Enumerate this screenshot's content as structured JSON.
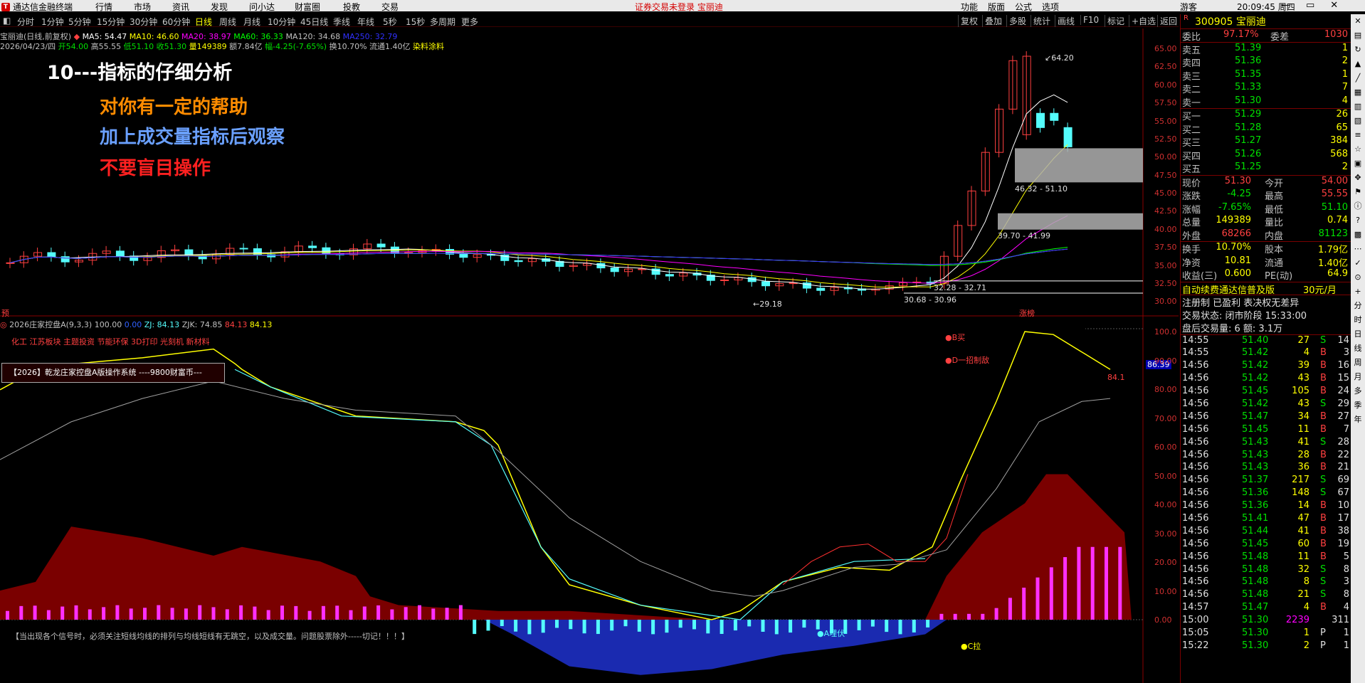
{
  "window": {
    "app_title": "通达信金融终端",
    "menus": [
      "行情",
      "市场",
      "资讯",
      "发现",
      "问小达",
      "财富圈",
      "投教",
      "交易"
    ],
    "login_warning": "证券交易未登录  宝丽迪",
    "right_menus": [
      "功能",
      "版面",
      "公式",
      "选项"
    ],
    "user": "游客",
    "clock": "20:09:45 周四",
    "controls": [
      "—",
      "▭",
      "✕"
    ]
  },
  "periods": [
    "分时",
    "1分钟",
    "5分钟",
    "15分钟",
    "30分钟",
    "60分钟",
    "日线",
    "周线",
    "月线",
    "10分钟",
    "45日线",
    "季线",
    "年线",
    "5秒",
    "15秒",
    "多周期",
    "更多"
  ],
  "active_period": "日线",
  "tools": [
    "复权",
    "叠加",
    "多股",
    "统计",
    "画线",
    "F10",
    "标记",
    "+自选",
    "返回"
  ],
  "stock": {
    "line1_name": "宝丽迪(日线,前复权)",
    "ma5": "MA5: 54.47",
    "ma10": "MA10: 46.60",
    "ma20": "MA20: 38.97",
    "ma60": "MA60: 36.33",
    "ma120": "MA120: 34.68",
    "ma250": "MA250: 32.79",
    "line2_date": "2026/04/23/四",
    "line2_open": "开54.00",
    "line2_high": "高55.55",
    "line2_low": "低51.10",
    "line2_close": "收51.30",
    "line2_vol": "量149389",
    "line2_amount": "额7.84亿",
    "line2_change": "幅-4.25(-7.65%)",
    "line2_turnover": "换10.70%",
    "line2_float": "流通1.40亿",
    "line2_industry": "染料涂料"
  },
  "overlay": {
    "title": "10---指标的仔细分析",
    "line1": "对你有一定的帮助",
    "line2": "加上成交量指标后观察",
    "line3": "不要盲目操作",
    "color_title": "#ffffff",
    "color_line1": "#ff8c00",
    "color_line2": "#6aa0ff",
    "color_line3": "#ff2020"
  },
  "price_annotations": {
    "high": "64.20",
    "low": "29.18",
    "zone1": "46.32 - 51.10",
    "zone2": "39.70 - 41.99",
    "zone3": "32.28 - 32.71",
    "zone4": "30.68 - 30.96",
    "pre_label": "预",
    "limit_up": "涨榜"
  },
  "price_scale": [
    "65.00",
    "62.50",
    "60.00",
    "57.50",
    "55.00",
    "52.50",
    "50.00",
    "47.50",
    "45.00",
    "42.50",
    "40.00",
    "37.50",
    "35.00",
    "32.50",
    "30.00"
  ],
  "indicator": {
    "name": "2026庄家控盘A(9,3,3)",
    "v1": "100.00",
    "v2": "0.00",
    "zj": "ZJ: 84.13",
    "zjk": "ZJK: 74.85",
    "v3": "84.13",
    "v4": "84.13",
    "tags": "化工 江苏板块 主题投资 节能环保 3D打印 光刻机 新材料",
    "banner": "【2026】乾龙庄家控盘A版操作系统 ----9800财富币---",
    "note": "【当出现各个信号时，必须关注短线均线的排列与均线短线有无跳空，以及成交量。问题股票除外-----切记！！！】",
    "sig_buy": "●B买",
    "sig_d": "●D一招制敌",
    "sig_a": "●A埋伏",
    "sig_c": "●C拉",
    "current_value": "86.39",
    "end_value": "84.1",
    "scale": [
      "100.0",
      "90.00",
      "80.00",
      "70.00",
      "60.00",
      "50.00",
      "40.00",
      "30.00",
      "20.00",
      "10.00",
      "0.00"
    ]
  },
  "quote": {
    "code": "300905",
    "name": "宝丽迪",
    "weibi_label": "委比",
    "weibi": "97.17%",
    "weicha_label": "委差",
    "weicha": "1030",
    "asks": [
      {
        "label": "卖五",
        "price": "51.39",
        "vol": "1"
      },
      {
        "label": "卖四",
        "price": "51.36",
        "vol": "2"
      },
      {
        "label": "卖三",
        "price": "51.35",
        "vol": "1"
      },
      {
        "label": "卖二",
        "price": "51.33",
        "vol": "7"
      },
      {
        "label": "卖一",
        "price": "51.30",
        "vol": "4"
      }
    ],
    "bids": [
      {
        "label": "买一",
        "price": "51.29",
        "vol": "26"
      },
      {
        "label": "买二",
        "price": "51.28",
        "vol": "65"
      },
      {
        "label": "买三",
        "price": "51.27",
        "vol": "384"
      },
      {
        "label": "买四",
        "price": "51.26",
        "vol": "568"
      },
      {
        "label": "买五",
        "price": "51.25",
        "vol": "2"
      }
    ],
    "stats": [
      {
        "l1": "现价",
        "v1": "51.30",
        "c1": "#ff4040",
        "l2": "今开",
        "v2": "54.00",
        "c2": "#ff4040"
      },
      {
        "l1": "涨跌",
        "v1": "-4.25",
        "c1": "#00e000",
        "l2": "最高",
        "v2": "55.55",
        "c2": "#ff4040"
      },
      {
        "l1": "涨幅",
        "v1": "-7.65%",
        "c1": "#00e000",
        "l2": "最低",
        "v2": "51.10",
        "c2": "#00e000"
      },
      {
        "l1": "总量",
        "v1": "149389",
        "c1": "#ffff00",
        "l2": "量比",
        "v2": "0.74",
        "c2": "#ffff00"
      },
      {
        "l1": "外盘",
        "v1": "68266",
        "c1": "#ff4040",
        "l2": "内盘",
        "v2": "81123",
        "c2": "#00e000"
      }
    ],
    "stats2": [
      {
        "l1": "换手",
        "v1": "10.70%",
        "l2": "股本",
        "v2": "1.79亿"
      },
      {
        "l1": "净资",
        "v1": "10.81",
        "l2": "流通",
        "v2": "1.40亿"
      },
      {
        "l1": "收益(三)",
        "v1": "0.600",
        "l2": "PE(动)",
        "v2": "64.9"
      }
    ],
    "promo": "自动续费通达信普及版",
    "promo_price": "30元/月",
    "reg_info": "注册制 已盈利 表决权无差异",
    "trade_status": "交易状态: 闭市阶段 15:33:00",
    "after_hours": "盘后交易量: 6  额: 3.1万",
    "ticks": [
      {
        "t": "14:55",
        "p": "51.40",
        "v": "27",
        "d": "S",
        "n": "14"
      },
      {
        "t": "14:55",
        "p": "51.42",
        "v": "4",
        "d": "B",
        "n": "3"
      },
      {
        "t": "14:56",
        "p": "51.42",
        "v": "39",
        "d": "B",
        "n": "16"
      },
      {
        "t": "14:56",
        "p": "51.42",
        "v": "43",
        "d": "B",
        "n": "15"
      },
      {
        "t": "14:56",
        "p": "51.45",
        "v": "105",
        "d": "B",
        "n": "24"
      },
      {
        "t": "14:56",
        "p": "51.42",
        "v": "43",
        "d": "S",
        "n": "29"
      },
      {
        "t": "14:56",
        "p": "51.47",
        "v": "34",
        "d": "B",
        "n": "27"
      },
      {
        "t": "14:56",
        "p": "51.45",
        "v": "11",
        "d": "B",
        "n": "7"
      },
      {
        "t": "14:56",
        "p": "51.43",
        "v": "41",
        "d": "S",
        "n": "28"
      },
      {
        "t": "14:56",
        "p": "51.43",
        "v": "28",
        "d": "B",
        "n": "22"
      },
      {
        "t": "14:56",
        "p": "51.43",
        "v": "36",
        "d": "B",
        "n": "21"
      },
      {
        "t": "14:56",
        "p": "51.37",
        "v": "217",
        "d": "S",
        "n": "69"
      },
      {
        "t": "14:56",
        "p": "51.36",
        "v": "148",
        "d": "S",
        "n": "67"
      },
      {
        "t": "14:56",
        "p": "51.36",
        "v": "14",
        "d": "B",
        "n": "10"
      },
      {
        "t": "14:56",
        "p": "51.41",
        "v": "47",
        "d": "B",
        "n": "17"
      },
      {
        "t": "14:56",
        "p": "51.44",
        "v": "41",
        "d": "B",
        "n": "38"
      },
      {
        "t": "14:56",
        "p": "51.45",
        "v": "60",
        "d": "B",
        "n": "19"
      },
      {
        "t": "14:56",
        "p": "51.48",
        "v": "11",
        "d": "B",
        "n": "5"
      },
      {
        "t": "14:56",
        "p": "51.48",
        "v": "32",
        "d": "S",
        "n": "8"
      },
      {
        "t": "14:56",
        "p": "51.48",
        "v": "8",
        "d": "S",
        "n": "3"
      },
      {
        "t": "14:56",
        "p": "51.48",
        "v": "21",
        "d": "S",
        "n": "8"
      },
      {
        "t": "14:57",
        "p": "51.47",
        "v": "4",
        "d": "B",
        "n": "4"
      },
      {
        "t": "15:00",
        "p": "51.30",
        "v": "2239",
        "d": "",
        "n": "311"
      },
      {
        "t": "15:05",
        "p": "51.30",
        "v": "1",
        "d": "P",
        "n": "1"
      },
      {
        "t": "15:22",
        "p": "51.30",
        "v": "2",
        "d": "P",
        "n": "1"
      }
    ]
  },
  "side_strip": [
    "分",
    "时",
    "日",
    "线",
    "周",
    "月",
    "多",
    "季",
    "年"
  ],
  "colors": {
    "up": "#ff4040",
    "down": "#54fcfc",
    "ma5": "#ffffff",
    "ma10": "#ffff00",
    "ma20": "#ff00ff",
    "ma60": "#00ff00",
    "ma120": "#c0c0c0",
    "ma250": "#3030ff"
  }
}
